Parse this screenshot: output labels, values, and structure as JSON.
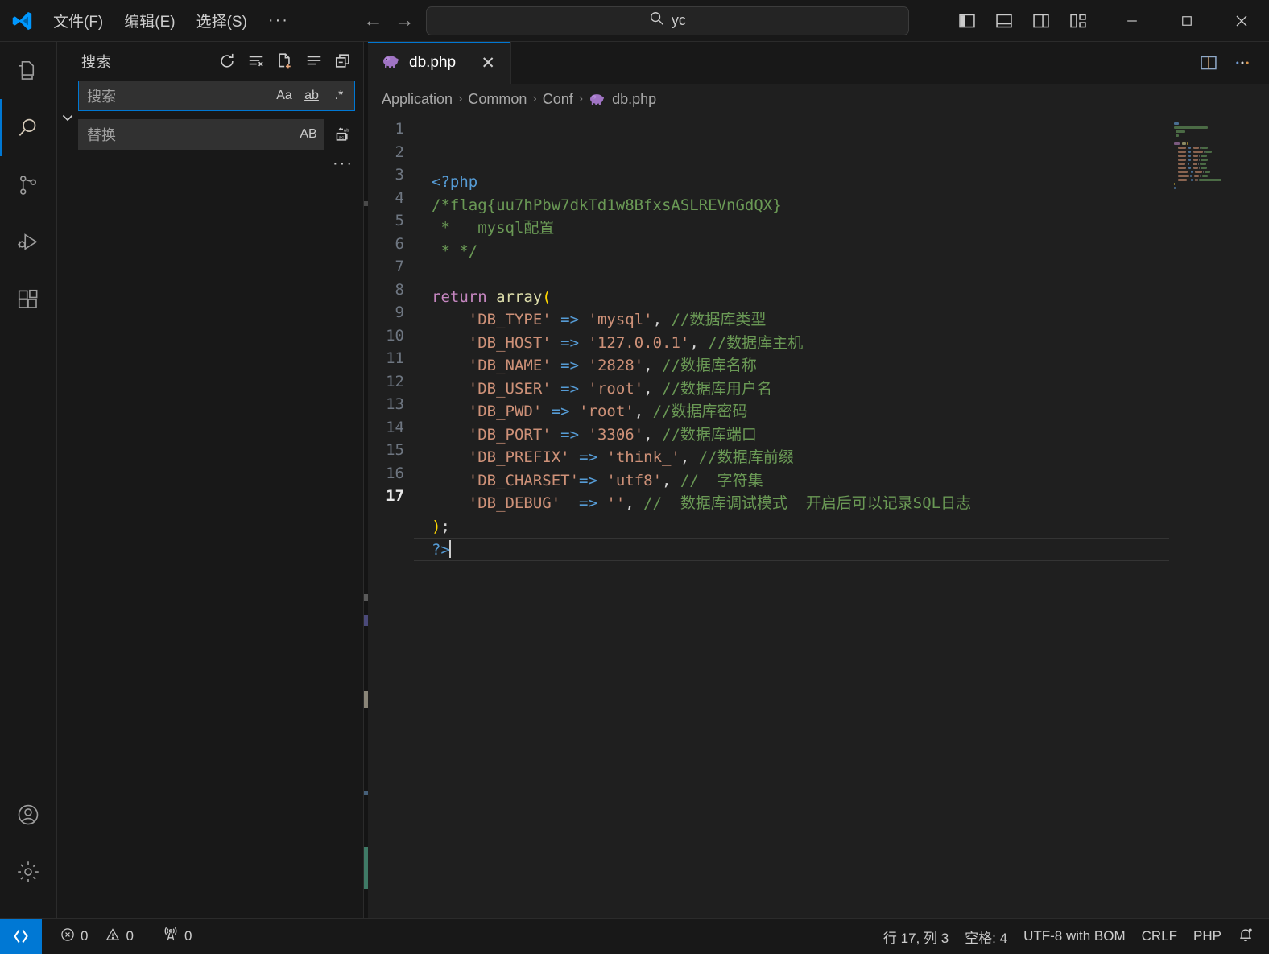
{
  "titlebar": {
    "logo_icon": "vscode-logo-icon",
    "menus": [
      {
        "label": "文件(F)",
        "name": "menu-file"
      },
      {
        "label": "编辑(E)",
        "name": "menu-edit"
      },
      {
        "label": "选择(S)",
        "name": "menu-selection"
      }
    ],
    "menu_overflow": "···",
    "nav_back": "←",
    "nav_forward": "→",
    "command_center": {
      "text": "yc",
      "icon": "search-icon"
    },
    "layout_buttons": [
      {
        "name": "toggle-primary-sidebar-button",
        "icon": "layout-sidebar-left-icon"
      },
      {
        "name": "toggle-panel-button",
        "icon": "layout-panel-icon"
      },
      {
        "name": "toggle-secondary-sidebar-button",
        "icon": "layout-sidebar-right-icon"
      },
      {
        "name": "customize-layout-button",
        "icon": "layout-customize-icon"
      }
    ],
    "window_controls": {
      "minimize": "—",
      "maximize": "□",
      "close": "✕"
    }
  },
  "activitybar": {
    "items": [
      {
        "name": "activitybar-explorer",
        "icon": "files-icon",
        "active": false
      },
      {
        "name": "activitybar-search",
        "icon": "search-icon",
        "active": true
      },
      {
        "name": "activitybar-source-control",
        "icon": "source-control-icon",
        "active": false
      },
      {
        "name": "activitybar-run-debug",
        "icon": "run-and-debug-icon",
        "active": false
      },
      {
        "name": "activitybar-extensions",
        "icon": "extensions-icon",
        "active": false
      }
    ],
    "bottom": [
      {
        "name": "activitybar-accounts",
        "icon": "account-icon"
      },
      {
        "name": "activitybar-settings",
        "icon": "gear-icon"
      }
    ]
  },
  "sidebar": {
    "title": "搜索",
    "actions": [
      {
        "name": "refresh-search-button",
        "icon": "refresh-icon"
      },
      {
        "name": "clear-search-results-button",
        "icon": "clear-all-icon"
      },
      {
        "name": "open-new-search-editor-button",
        "icon": "new-file-icon"
      },
      {
        "name": "view-as-list-button",
        "icon": "list-flat-icon"
      },
      {
        "name": "collapse-all-button",
        "icon": "collapse-all-icon"
      }
    ],
    "toggle_replace_icon": "chevron-down-icon",
    "search_input": {
      "placeholder": "搜索",
      "value": "",
      "options": [
        {
          "name": "match-case-toggle",
          "label": "Aa"
        },
        {
          "name": "match-whole-word-toggle",
          "label": "ab"
        },
        {
          "name": "use-regex-toggle",
          "label": ".*"
        }
      ]
    },
    "replace_input": {
      "placeholder": "替换",
      "value": "",
      "options": [
        {
          "name": "preserve-case-toggle",
          "label": "AB"
        }
      ],
      "replace_all_icon": "replace-all-icon"
    },
    "more_actions": "···"
  },
  "editor": {
    "tabs": [
      {
        "label": "db.php",
        "icon": "php-elephant-icon",
        "active": true,
        "close": "✕"
      }
    ],
    "actions": [
      {
        "name": "split-editor-right-button",
        "icon": "split-editor-icon"
      },
      {
        "name": "editor-more-actions-button",
        "icon": "ellipsis-icon"
      }
    ],
    "breadcrumbs": [
      "Application",
      "Common",
      "Conf",
      "db.php"
    ],
    "breadcrumb_separator": "›",
    "breadcrumb_file_icon": "php-elephant-icon",
    "line_numbers": [
      1,
      2,
      3,
      4,
      5,
      6,
      7,
      8,
      9,
      10,
      11,
      12,
      13,
      14,
      15,
      16,
      17
    ],
    "active_line": 17,
    "code_lines": [
      {
        "n": 1,
        "tokens": [
          {
            "t": "<?php",
            "c": "tag"
          }
        ]
      },
      {
        "n": 2,
        "tokens": [
          {
            "t": "/*flag{uu7hPbw7dkTd1w8BfxsASLREVnGdQX}",
            "c": "com"
          }
        ]
      },
      {
        "n": 3,
        "tokens": [
          {
            "t": " *   mysql配置",
            "c": "com"
          }
        ]
      },
      {
        "n": 4,
        "tokens": [
          {
            "t": " * */",
            "c": "com"
          }
        ]
      },
      {
        "n": 5,
        "tokens": []
      },
      {
        "n": 6,
        "tokens": [
          {
            "t": "return",
            "c": "kw"
          },
          {
            "t": " ",
            "c": "plain"
          },
          {
            "t": "array",
            "c": "fn"
          },
          {
            "t": "(",
            "c": "punc"
          }
        ]
      },
      {
        "n": 7,
        "tokens": [
          {
            "t": "    ",
            "c": "plain"
          },
          {
            "t": "'DB_TYPE'",
            "c": "str"
          },
          {
            "t": " ",
            "c": "plain"
          },
          {
            "t": "=>",
            "c": "op"
          },
          {
            "t": " ",
            "c": "plain"
          },
          {
            "t": "'mysql'",
            "c": "str"
          },
          {
            "t": ", ",
            "c": "plain"
          },
          {
            "t": "//数据库类型",
            "c": "com"
          }
        ]
      },
      {
        "n": 8,
        "tokens": [
          {
            "t": "    ",
            "c": "plain"
          },
          {
            "t": "'DB_HOST'",
            "c": "str"
          },
          {
            "t": " ",
            "c": "plain"
          },
          {
            "t": "=>",
            "c": "op"
          },
          {
            "t": " ",
            "c": "plain"
          },
          {
            "t": "'127.0.0.1'",
            "c": "str"
          },
          {
            "t": ", ",
            "c": "plain"
          },
          {
            "t": "//数据库主机",
            "c": "com"
          }
        ]
      },
      {
        "n": 9,
        "tokens": [
          {
            "t": "    ",
            "c": "plain"
          },
          {
            "t": "'DB_NAME'",
            "c": "str"
          },
          {
            "t": " ",
            "c": "plain"
          },
          {
            "t": "=>",
            "c": "op"
          },
          {
            "t": " ",
            "c": "plain"
          },
          {
            "t": "'2828'",
            "c": "str"
          },
          {
            "t": ", ",
            "c": "plain"
          },
          {
            "t": "//数据库名称",
            "c": "com"
          }
        ]
      },
      {
        "n": 10,
        "tokens": [
          {
            "t": "    ",
            "c": "plain"
          },
          {
            "t": "'DB_USER'",
            "c": "str"
          },
          {
            "t": " ",
            "c": "plain"
          },
          {
            "t": "=>",
            "c": "op"
          },
          {
            "t": " ",
            "c": "plain"
          },
          {
            "t": "'root'",
            "c": "str"
          },
          {
            "t": ", ",
            "c": "plain"
          },
          {
            "t": "//数据库用户名",
            "c": "com"
          }
        ]
      },
      {
        "n": 11,
        "tokens": [
          {
            "t": "    ",
            "c": "plain"
          },
          {
            "t": "'DB_PWD'",
            "c": "str"
          },
          {
            "t": " ",
            "c": "plain"
          },
          {
            "t": "=>",
            "c": "op"
          },
          {
            "t": " ",
            "c": "plain"
          },
          {
            "t": "'root'",
            "c": "str"
          },
          {
            "t": ", ",
            "c": "plain"
          },
          {
            "t": "//数据库密码",
            "c": "com"
          }
        ]
      },
      {
        "n": 12,
        "tokens": [
          {
            "t": "    ",
            "c": "plain"
          },
          {
            "t": "'DB_PORT'",
            "c": "str"
          },
          {
            "t": " ",
            "c": "plain"
          },
          {
            "t": "=>",
            "c": "op"
          },
          {
            "t": " ",
            "c": "plain"
          },
          {
            "t": "'3306'",
            "c": "str"
          },
          {
            "t": ", ",
            "c": "plain"
          },
          {
            "t": "//数据库端口",
            "c": "com"
          }
        ]
      },
      {
        "n": 13,
        "tokens": [
          {
            "t": "    ",
            "c": "plain"
          },
          {
            "t": "'DB_PREFIX'",
            "c": "str"
          },
          {
            "t": " ",
            "c": "plain"
          },
          {
            "t": "=>",
            "c": "op"
          },
          {
            "t": " ",
            "c": "plain"
          },
          {
            "t": "'think_'",
            "c": "str"
          },
          {
            "t": ", ",
            "c": "plain"
          },
          {
            "t": "//数据库前缀",
            "c": "com"
          }
        ]
      },
      {
        "n": 14,
        "tokens": [
          {
            "t": "    ",
            "c": "plain"
          },
          {
            "t": "'DB_CHARSET'",
            "c": "str"
          },
          {
            "t": "=>",
            "c": "op"
          },
          {
            "t": " ",
            "c": "plain"
          },
          {
            "t": "'utf8'",
            "c": "str"
          },
          {
            "t": ", ",
            "c": "plain"
          },
          {
            "t": "//  字符集",
            "c": "com"
          }
        ]
      },
      {
        "n": 15,
        "tokens": [
          {
            "t": "    ",
            "c": "plain"
          },
          {
            "t": "'DB_DEBUG'",
            "c": "str"
          },
          {
            "t": "  ",
            "c": "plain"
          },
          {
            "t": "=>",
            "c": "op"
          },
          {
            "t": " ",
            "c": "plain"
          },
          {
            "t": "''",
            "c": "str"
          },
          {
            "t": ", ",
            "c": "plain"
          },
          {
            "t": "//  数据库调试模式  开启后可以记录SQL日志",
            "c": "com"
          }
        ]
      },
      {
        "n": 16,
        "tokens": [
          {
            "t": ")",
            "c": "punc"
          },
          {
            "t": ";",
            "c": "plain"
          }
        ]
      },
      {
        "n": 17,
        "tokens": [
          {
            "t": "?>",
            "c": "tag"
          }
        ]
      }
    ]
  },
  "statusbar": {
    "remote_icon": "remote-window-icon",
    "left_items": [
      {
        "name": "problems-errors",
        "icon": "error-icon",
        "label": "0"
      },
      {
        "name": "problems-warnings",
        "icon": "warning-icon",
        "label": "0"
      },
      {
        "name": "ports-forwarded",
        "icon": "radio-tower-icon",
        "label": "0"
      }
    ],
    "right_items": [
      {
        "name": "editor-cursor-position",
        "label": "行 17, 列 3"
      },
      {
        "name": "editor-indentation",
        "label": "空格: 4"
      },
      {
        "name": "editor-encoding",
        "label": "UTF-8 with BOM"
      },
      {
        "name": "editor-eol",
        "label": "CRLF"
      },
      {
        "name": "editor-language-mode",
        "label": "PHP"
      },
      {
        "name": "notifications-bell",
        "label": "",
        "icon": "bell-dot-icon"
      }
    ]
  },
  "colors": {
    "accent": "#0078d4",
    "titlebar_bg": "#181818",
    "editor_bg": "#1f1f1f",
    "sidebar_bg": "#181818",
    "string": "#ce9178",
    "comment": "#6a9955",
    "keyword": "#c586c0",
    "function": "#dcdcaa",
    "tag": "#569cd6",
    "punctuation": "#ffd700"
  }
}
